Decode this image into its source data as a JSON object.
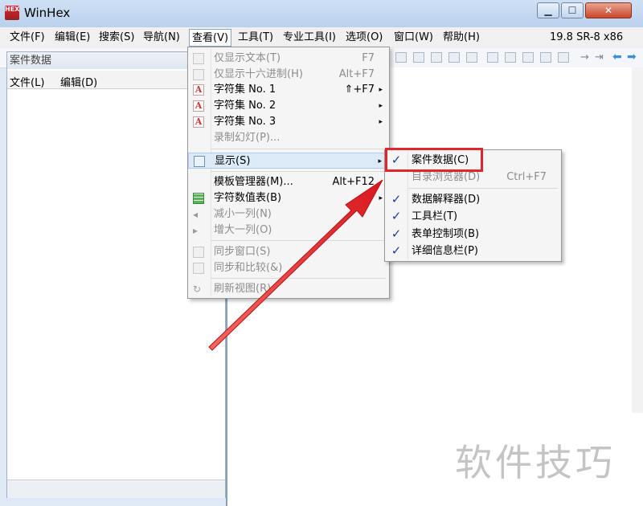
{
  "window": {
    "title": "WinHex",
    "logo_text": "HEX"
  },
  "menubar": {
    "items": [
      "文件(F)",
      "编辑(E)",
      "搜索(S)",
      "导航(N)",
      "查看(V)",
      "工具(T)",
      "专业工具(I)",
      "选项(O)",
      "窗口(W)",
      "帮助(H)"
    ],
    "version": "19.8 SR-8 x86"
  },
  "case_panel": {
    "title": "案件数据",
    "menu": [
      "文件(L)",
      "编辑(D)"
    ]
  },
  "view_menu": {
    "items": [
      {
        "label": "仅显示文本(T)",
        "shortcut": "F7",
        "enabled": false,
        "icon": "checkbox-icon"
      },
      {
        "label": "仅显示十六进制(H)",
        "shortcut": "Alt+F7",
        "enabled": false,
        "icon": "checkbox-icon"
      },
      {
        "label": "字符集 No. 1",
        "shortcut": "⇑+F7",
        "enabled": true,
        "icon": "charset-icon",
        "submenu": true
      },
      {
        "label": "字符集 No. 2",
        "shortcut": "",
        "enabled": true,
        "icon": "charset-icon",
        "submenu": true
      },
      {
        "label": "字符集 No. 3",
        "shortcut": "",
        "enabled": true,
        "icon": "charset-icon",
        "submenu": true
      },
      {
        "label": "录制幻灯(P)...",
        "shortcut": "",
        "enabled": false,
        "icon": ""
      },
      {
        "label": "显示(S)",
        "shortcut": "",
        "enabled": true,
        "icon": "display-icon",
        "submenu": true,
        "highlighted": true
      },
      {
        "label": "模板管理器(M)...",
        "shortcut": "Alt+F12",
        "enabled": true,
        "icon": ""
      },
      {
        "label": "字符数值表(B)",
        "shortcut": "",
        "enabled": true,
        "icon": "table-icon",
        "submenu": true
      },
      {
        "label": "减小一列(N)",
        "shortcut": "",
        "enabled": false,
        "icon": "shrink-icon"
      },
      {
        "label": "增大一列(O)",
        "shortcut": "",
        "enabled": false,
        "icon": "grow-icon"
      },
      {
        "label": "同步窗口(S)",
        "shortcut": "",
        "enabled": false,
        "icon": "checkbox-icon"
      },
      {
        "label": "同步和比较(&)",
        "shortcut": "",
        "enabled": false,
        "icon": "checkbox-icon"
      },
      {
        "label": "刷新视图(R)",
        "shortcut": "",
        "enabled": false,
        "icon": "refresh-icon"
      }
    ]
  },
  "display_submenu": {
    "items": [
      {
        "label": "案件数据(C)",
        "shortcut": "",
        "checked": true,
        "enabled": true
      },
      {
        "label": "目录浏览器(D)",
        "shortcut": "Ctrl+F7",
        "checked": false,
        "enabled": false
      },
      {
        "label": "数据解释器(D)",
        "shortcut": "",
        "checked": true,
        "enabled": true
      },
      {
        "label": "工具栏(T)",
        "shortcut": "",
        "checked": true,
        "enabled": true
      },
      {
        "label": "表单控制项(B)",
        "shortcut": "",
        "checked": true,
        "enabled": true
      },
      {
        "label": "详细信息栏(P)",
        "shortcut": "",
        "checked": true,
        "enabled": true
      }
    ]
  },
  "annotation": {
    "highlight_color": "#e0262b",
    "arrow_color": "#e0262b"
  },
  "watermark": "软件技巧",
  "check_glyph": "✓",
  "arrow_glyph": "▸"
}
